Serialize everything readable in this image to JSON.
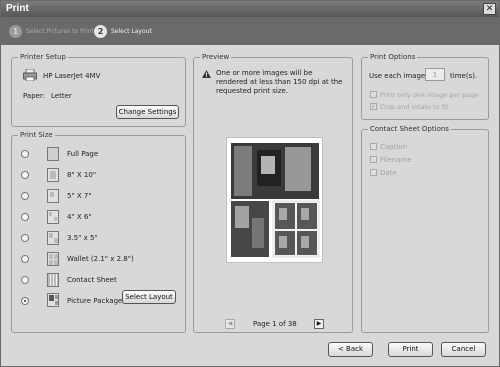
{
  "window": {
    "title": "Print"
  },
  "wizard": {
    "steps": [
      {
        "num": "1",
        "label": "Select Pictures to Print"
      },
      {
        "num": "2",
        "label": "Select Layout"
      }
    ]
  },
  "printer_setup": {
    "legend": "Printer Setup",
    "printer_name": "HP LaserJet 4MV",
    "paper_label": "Paper:",
    "paper_value": "Letter",
    "change_button": "Change Settings"
  },
  "print_size": {
    "legend": "Print Size",
    "options": [
      {
        "label": "Full Page",
        "selected": false,
        "icon": "full-page-icon"
      },
      {
        "label": "8\" X 10\"",
        "selected": false,
        "icon": "8x10-icon"
      },
      {
        "label": "5\" X 7\"",
        "selected": false,
        "icon": "5x7-icon"
      },
      {
        "label": "4\" X 6\"",
        "selected": false,
        "icon": "4x6-icon"
      },
      {
        "label": "3.5\" x 5\"",
        "selected": false,
        "icon": "3.5x5-icon"
      },
      {
        "label": "Wallet (2.1\" x 2.8\")",
        "selected": false,
        "icon": "wallet-icon"
      },
      {
        "label": "Contact Sheet",
        "selected": false,
        "icon": "contact-sheet-icon"
      },
      {
        "label": "Picture Package",
        "selected": true,
        "icon": "picture-package-icon"
      }
    ],
    "select_layout_button": "Select Layout"
  },
  "preview": {
    "legend": "Preview",
    "warning": "One or more images will be rendered at less than 150 dpi at the requested print size.",
    "page_label": "Page 1 of 38"
  },
  "print_options": {
    "legend": "Print Options",
    "use_each_label": "Use each image",
    "times_value": "1",
    "times_suffix": "time(s).",
    "only_one": {
      "label": "Print only one image per page",
      "checked": false
    },
    "crop_rotate": {
      "label": "Crop and rotate to fit",
      "checked": true
    }
  },
  "contact_sheet_options": {
    "legend": "Contact Sheet Options",
    "caption": "Caption",
    "filename": "Filename",
    "date": "Date"
  },
  "buttons": {
    "back": "< Back",
    "print": "Print",
    "cancel": "Cancel"
  }
}
